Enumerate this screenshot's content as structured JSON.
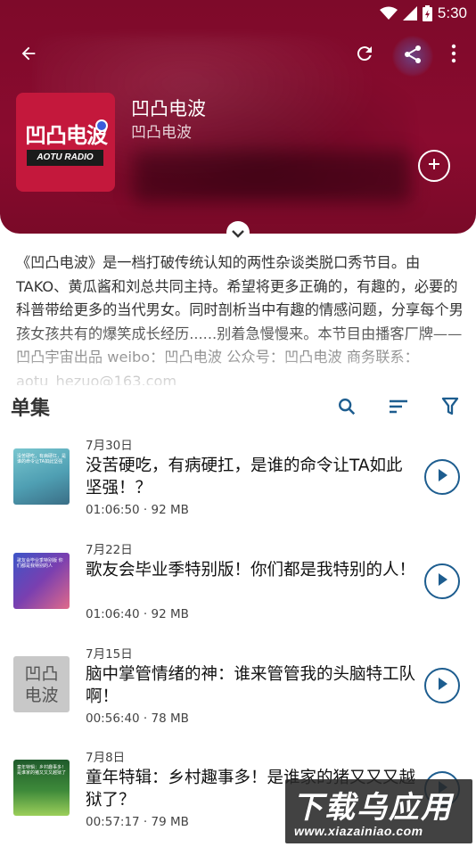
{
  "status_bar": {
    "time": "5:30"
  },
  "podcast": {
    "title": "凹凸电波",
    "author": "凹凸电波",
    "cover_title": "凹凸电波",
    "cover_subtitle": "AOTU RADIO",
    "description": "《凹凸电波》是一档打破传统认知的两性杂谈类脱口秀节目。由TAKO、黄瓜酱和刘总共同主持。希望将更多正确的，有趣的，必要的科普带给更多的当代男女。同时剖析当中有趣的情感问题，分享每个男孩女孩共有的爆笑成长经历......别着急慢慢来。本节目由播客厂牌——凹凸宇宙出品 weibo：凹凸电波 公众号：凹凸电波 商务联系：aotu_hezuo@163.com"
  },
  "colors": {
    "header_bg": "#8a0b2f",
    "accent": "#1d5d8f"
  },
  "episodes_section": {
    "heading": "单集"
  },
  "episodes": [
    {
      "date": "7月30日",
      "title": "没苦硬吃，有病硬扛，是谁的命令让TA如此坚强！？",
      "meta": "01:06:50 · 92 MB",
      "thumb_text": "没苦硬吃，有病硬扛，是谁的命令让TA如此坚强"
    },
    {
      "date": "7月22日",
      "title": "歌友会毕业季特别版！你们都是我特别的人！",
      "meta": "01:06:40 · 92 MB",
      "thumb_text": "歌友会毕业季特别版 你们都是我特别的人"
    },
    {
      "date": "7月15日",
      "title": "脑中掌管情绪的神：谁来管管我的头脑特工队啊！",
      "meta": "00:56:40 · 78 MB",
      "thumb_text": "凹凸电波"
    },
    {
      "date": "7月8日",
      "title": "童年特辑：乡村趣事多！是谁家的猪又又又越狱了？",
      "meta": "00:57:17 · 79 MB",
      "thumb_text": "童年特辑：乡村趣事多！是谁家的猪又又又越狱了"
    }
  ],
  "watermark": {
    "big": "下载乌应用",
    "small": "www.xiazainiao.com"
  }
}
